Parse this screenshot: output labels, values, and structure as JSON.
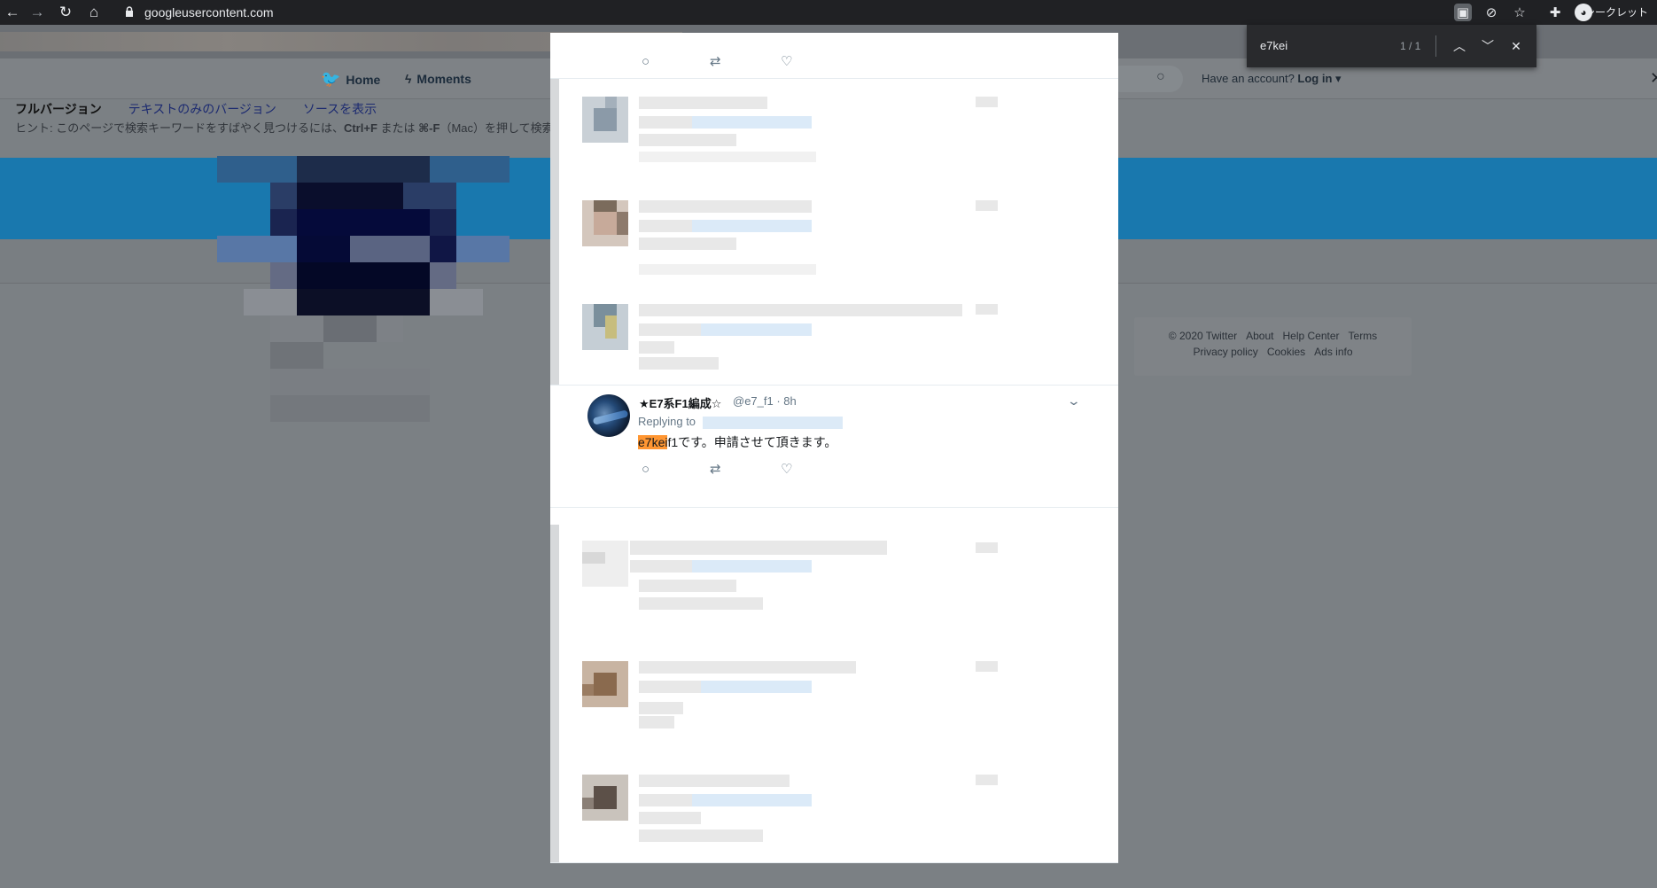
{
  "browser": {
    "url": "googleusercontent.com",
    "incognito_label": "シークレット"
  },
  "find_bar": {
    "query": "e7kei",
    "count": "1 / 1"
  },
  "twitter_header": {
    "home_label": "Home",
    "moments_label": "Moments",
    "account_prompt": "Have an account?",
    "login_label": "Log in"
  },
  "cache_bar": {
    "links": [
      "フルバージョン",
      "テキストのみのバージョン",
      "ソースを表示"
    ],
    "hint_prefix": "ヒント: このページで検索キーワードをすばやく見つけるには、",
    "hint_key1": "Ctrl+F",
    "hint_mid": " または ",
    "hint_key2": "⌘-F",
    "hint_suffix": "（Mac）を押して検索"
  },
  "footer": {
    "row1": [
      "© 2020 Twitter",
      "About",
      "Help Center",
      "Terms"
    ],
    "row2": [
      "Privacy policy",
      "Cookies",
      "Ads info"
    ]
  },
  "tweet": {
    "name": "★E7系F1編成☆",
    "handle": "@e7_f1 · 8h",
    "replying_to": "Replying to",
    "text_highlight": "e7kei",
    "text_rest": "f1です。申請させて頂きます。"
  },
  "colors": {
    "find_highlight": "#ff9632",
    "twitter_blue": "#1978ae",
    "overlay_gray": "#7b8084"
  }
}
